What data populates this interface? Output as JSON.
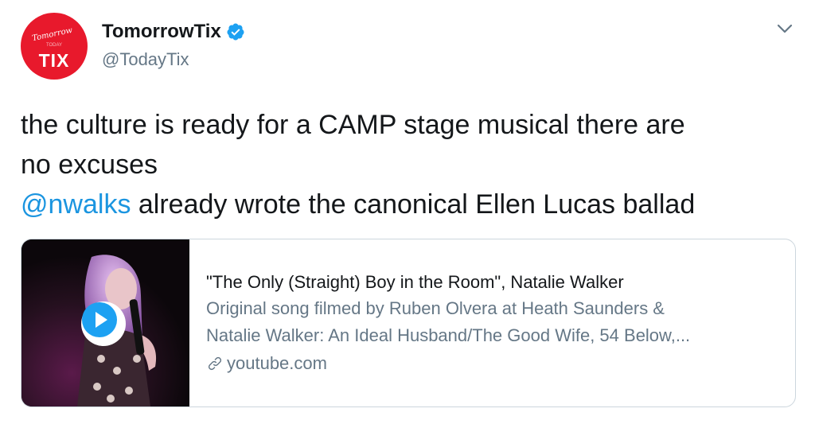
{
  "account": {
    "avatar_text": "TIX",
    "avatar_script": "Tomorrow",
    "avatar_strike": "TODAY",
    "display_name": "TomorrowTix",
    "handle": "@TodayTix",
    "verified": true,
    "avatar_color": "#e8192c"
  },
  "tweet": {
    "line1": "the culture is ready for a CAMP stage musical there are",
    "line2": "no excuses",
    "mention": "@nwalks",
    "line3_rest": " already wrote the canonical Ellen Lucas ballad"
  },
  "card": {
    "title": "\"The Only (Straight) Boy in the Room\", Natalie Walker",
    "desc_line1": "Original song filmed by Ruben Olvera at Heath Saunders &",
    "desc_line2": "Natalie Walker: An Ideal Husband/The Good Wife, 54 Below,...",
    "domain": "youtube.com"
  },
  "colors": {
    "link_blue": "#1b95e0",
    "verified_blue": "#1da1f2",
    "muted": "#657786",
    "text": "#14171a",
    "border": "#ccd6dd"
  },
  "icons": {
    "verified": "verified-badge-icon",
    "caret": "chevron-down-icon",
    "play": "play-icon",
    "link": "link-icon"
  }
}
